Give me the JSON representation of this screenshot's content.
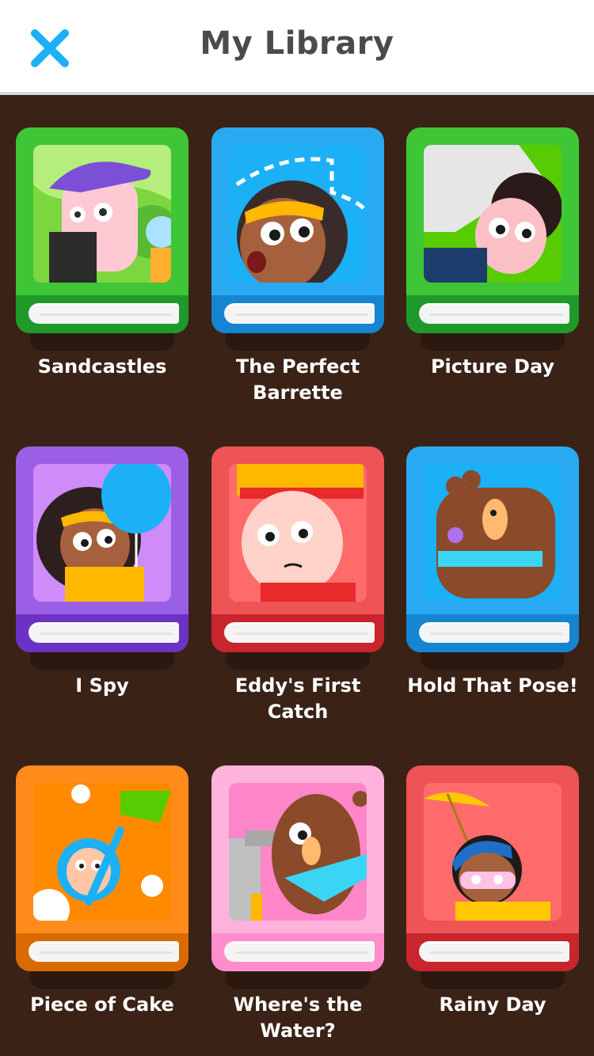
{
  "header": {
    "title": "My Library",
    "close_icon": "close-icon"
  },
  "books": [
    {
      "title": "Sandcastles",
      "color": "green"
    },
    {
      "title": "The Perfect Barrette",
      "color": "blue"
    },
    {
      "title": "Picture Day",
      "color": "green"
    },
    {
      "title": "I Spy",
      "color": "purple"
    },
    {
      "title": "Eddy's First Catch",
      "color": "red"
    },
    {
      "title": "Hold That Pose!",
      "color": "blue"
    },
    {
      "title": "Piece of Cake",
      "color": "orange"
    },
    {
      "title": "Where's the Water?",
      "color": "pink"
    },
    {
      "title": "Rainy Day",
      "color": "red"
    }
  ],
  "colors": {
    "background": "#3b2216",
    "header_bg": "#ffffff",
    "title_text": "#4b4b4b",
    "close_icon": "#1cb0f6",
    "book_green": "#3ec636",
    "book_blue": "#2aa9f3",
    "book_purple": "#9b5fe6",
    "book_red": "#ee5356",
    "book_orange": "#ff8c1a",
    "book_pink": "#ff9fd4"
  }
}
